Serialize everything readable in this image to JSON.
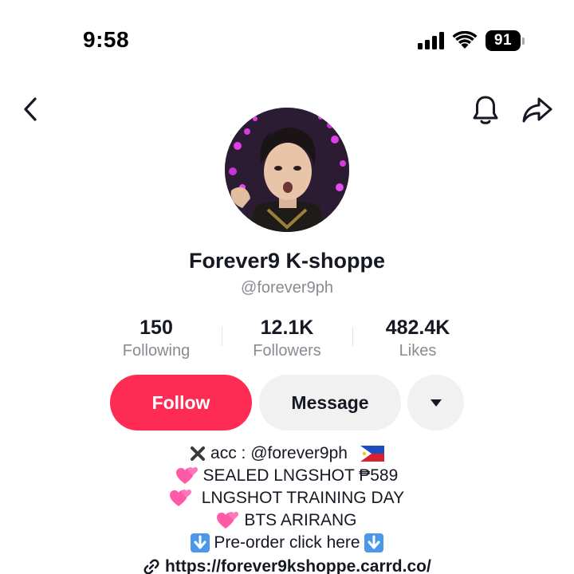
{
  "status_bar": {
    "time": "9:58",
    "battery": "91",
    "icons": [
      "cellular-signal-icon",
      "wifi-icon",
      "battery-icon"
    ]
  },
  "nav": {
    "back_icon": "chevron-left-icon",
    "bell_icon": "bell-icon",
    "share_icon": "share-arrow-icon"
  },
  "profile": {
    "display_name": "Forever9 K-shoppe",
    "username": "@forever9ph"
  },
  "stats": [
    {
      "value": "150",
      "label": "Following"
    },
    {
      "value": "12.1K",
      "label": "Followers"
    },
    {
      "value": "482.4K",
      "label": "Likes"
    }
  ],
  "actions": {
    "follow_label": "Follow",
    "message_label": "Message",
    "more_icon": "caret-down-icon"
  },
  "bio": {
    "line1": "acc : @forever9ph",
    "line2": "SEALED LNGSHOT ₱589",
    "line3": "LNGSHOT TRAINING DAY",
    "line4": "BTS ARIRANG",
    "line5": "Pre-order click here",
    "link": "https://forever9kshoppe.carrd.co/"
  },
  "colors": {
    "accent": "#fe2c55",
    "secondary_button": "#f1f1f2",
    "muted_text": "#8a8b91",
    "primary_text": "#161823"
  }
}
